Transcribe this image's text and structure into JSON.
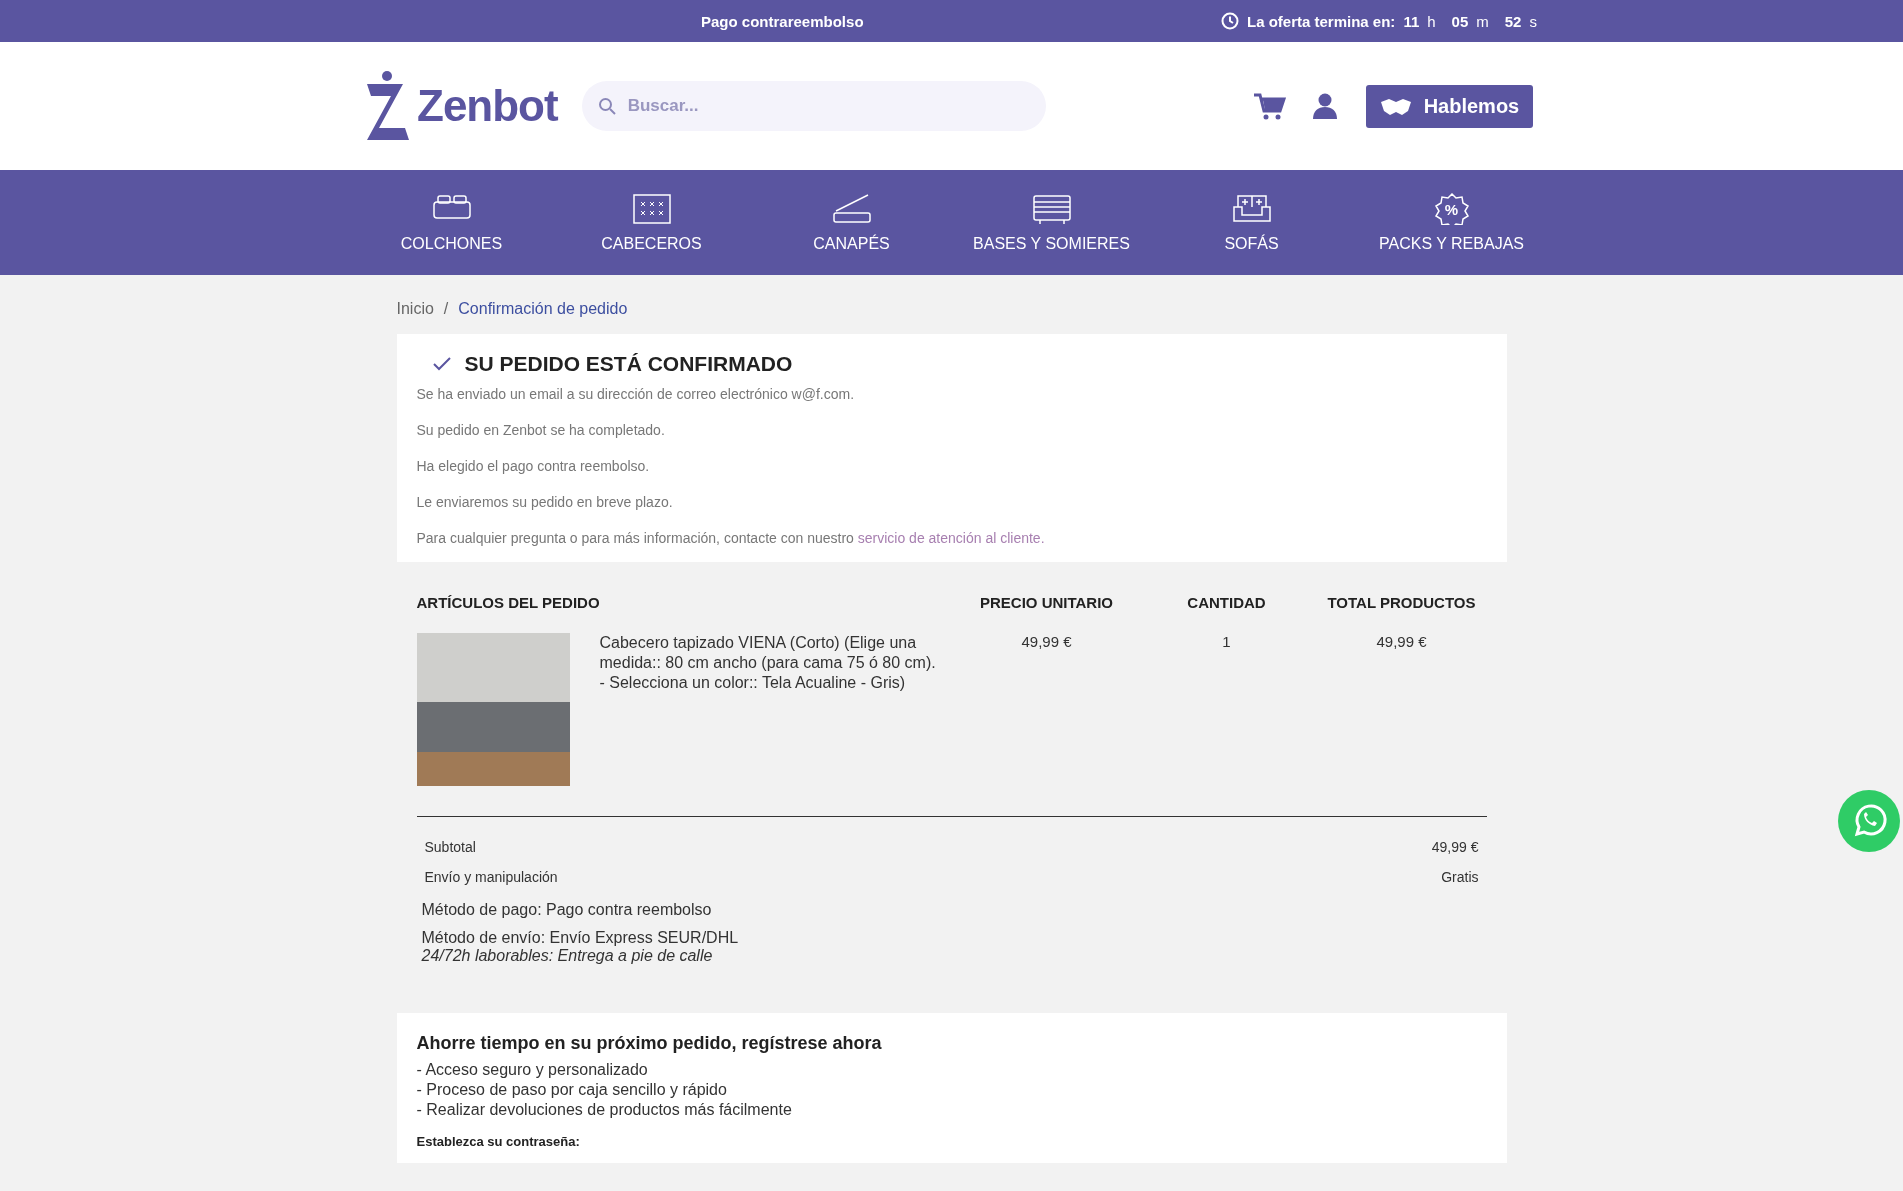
{
  "top_bar": {
    "message": "Pago contrareembolso",
    "offer_label": "La oferta termina en:",
    "countdown": [
      {
        "value": "11",
        "unit": "h"
      },
      {
        "value": "05",
        "unit": "m"
      },
      {
        "value": "52",
        "unit": "s"
      }
    ]
  },
  "header": {
    "logo": "Zenbot",
    "search": {
      "placeholder": "Buscar..."
    },
    "contact_button": "Hablemos"
  },
  "nav": [
    {
      "label": "COLCHONES",
      "kind": "mattress"
    },
    {
      "label": "CABECEROS",
      "kind": "headboard"
    },
    {
      "label": "CANAPÉS",
      "kind": "storage"
    },
    {
      "label": "BASES Y SOMIERES",
      "kind": "base"
    },
    {
      "label": "SOFÁS",
      "kind": "sofa"
    },
    {
      "label": "PACKS Y REBAJAS",
      "kind": "discount",
      "icon_text": "%"
    }
  ],
  "breadcrumb_separator": "/",
  "breadcrumb": [
    {
      "label": "Inicio",
      "selected": false
    },
    {
      "label": "Confirmación de pedido",
      "selected": true
    }
  ],
  "confirmation": {
    "title": "SU PEDIDO ESTÁ CONFIRMADO",
    "lines": [
      "Se ha enviado un email a su dirección de correo electrónico w@f.com.",
      "Su pedido en Zenbot se ha completado.",
      "Ha elegido el pago contra reembolso.",
      "Le enviaremos su pedido en breve plazo."
    ],
    "contact_text": "Para cualquier pregunta o para más información, contacte con nuestro",
    "contact_link": "servicio de atención al cliente."
  },
  "order": {
    "columns": [
      "ARTÍCULOS DEL PEDIDO",
      "PRECIO UNITARIO",
      "CANTIDAD",
      "TOTAL PRODUCTOS"
    ],
    "items": [
      {
        "name": "Cabecero tapizado VIENA (Corto) (Elige una medida:: 80 cm ancho (para cama 75 ó 80 cm). - Selecciona un color:: Tela Acualine - Gris)",
        "unit_price": "49,99 €",
        "quantity": "1",
        "total": "49,99 €"
      }
    ],
    "totals": [
      {
        "label": "Subtotal",
        "value": "49,99 €"
      },
      {
        "label": "Envío y manipulación",
        "value": "Gratis"
      }
    ],
    "payment_method": "Método de pago: Pago contra reembolso",
    "shipping_method": "Método de envío: Envío Express SEUR/DHL",
    "shipping_note": "24/72h laborables: Entrega a pie de calle"
  },
  "register": {
    "title": "Ahorre tiempo en su próximo pedido, regístrese ahora",
    "benefits": [
      "- Acceso seguro y personalizado",
      "- Proceso de paso por caja sencillo y rápido",
      "- Realizar devoluciones de productos más fácilmente"
    ],
    "password_label": "Establezca su contraseña:"
  }
}
